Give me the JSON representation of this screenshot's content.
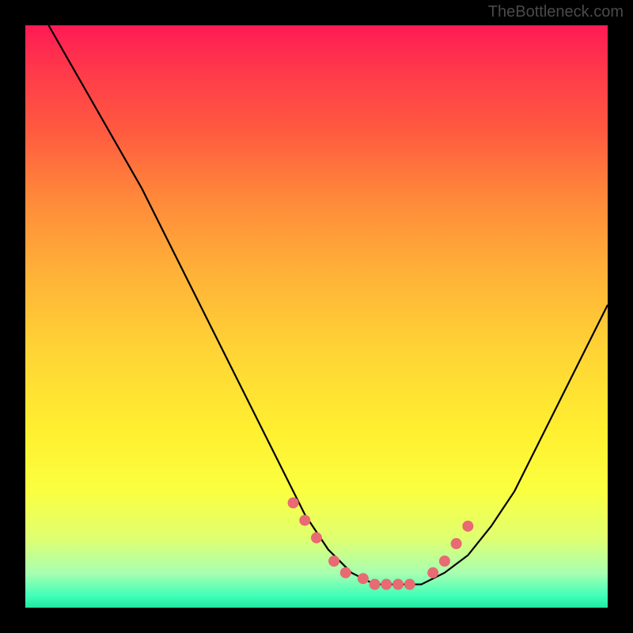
{
  "watermark": "TheBottleneck.com",
  "chart_data": {
    "type": "line",
    "title": "",
    "xlabel": "",
    "ylabel": "",
    "xlim": [
      0,
      100
    ],
    "ylim": [
      0,
      100
    ],
    "curve": {
      "x": [
        4,
        8,
        12,
        16,
        20,
        24,
        28,
        32,
        36,
        40,
        44,
        48,
        52,
        56,
        60,
        64,
        68,
        72,
        76,
        80,
        84,
        88,
        92,
        96,
        100
      ],
      "y": [
        100,
        93,
        86,
        79,
        72,
        64,
        56,
        48,
        40,
        32,
        24,
        16,
        10,
        6,
        4,
        4,
        4,
        6,
        9,
        14,
        20,
        28,
        36,
        44,
        52
      ]
    },
    "markers": {
      "x": [
        46,
        48,
        50,
        53,
        55,
        58,
        60,
        62,
        64,
        66,
        70,
        72,
        74,
        76
      ],
      "y": [
        18,
        15,
        12,
        8,
        6,
        5,
        4,
        4,
        4,
        4,
        6,
        8,
        11,
        14
      ],
      "color": "#e86a72",
      "size": 7
    },
    "curve_color": "#000000",
    "curve_width": 2.2
  }
}
